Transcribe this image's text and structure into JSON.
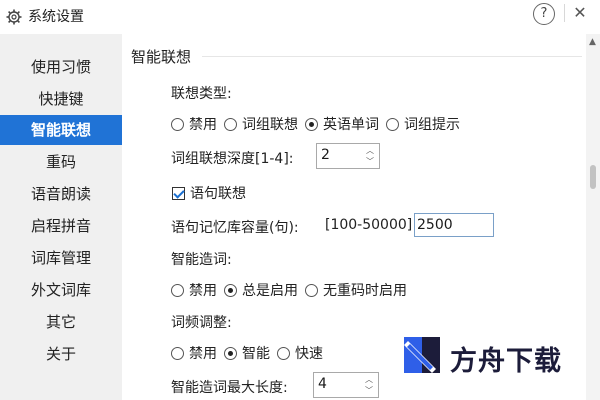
{
  "window": {
    "title": "系统设置",
    "help_label": "?",
    "close_label": "✕"
  },
  "sidebar": {
    "items": [
      {
        "label": "使用习惯"
      },
      {
        "label": "快捷键"
      },
      {
        "label": "智能联想",
        "active": true
      },
      {
        "label": "重码"
      },
      {
        "label": "语音朗读"
      },
      {
        "label": "启程拼音"
      },
      {
        "label": "词库管理"
      },
      {
        "label": "外文词库"
      },
      {
        "label": "其它"
      },
      {
        "label": "关于"
      }
    ]
  },
  "content": {
    "section_title": "智能联想",
    "assoc_type": {
      "label": "联想类型:",
      "options": [
        "禁用",
        "词组联想",
        "英语单词",
        "词组提示"
      ],
      "selected": "英语单词"
    },
    "phrase_depth": {
      "label": "词组联想深度[1-4]:",
      "value": "2"
    },
    "sentence_assoc": {
      "label": "语句联想",
      "checked": true
    },
    "sentence_memory": {
      "label": "语句记忆库容量(句):",
      "range": "[100-50000]",
      "value": "2500"
    },
    "smart_word": {
      "label": "智能造词:",
      "options": [
        "禁用",
        "总是启用",
        "无重码时启用"
      ],
      "selected": "总是启用"
    },
    "freq_adjust": {
      "label": "词频调整:",
      "options": [
        "禁用",
        "智能",
        "快速"
      ],
      "selected": "智能"
    },
    "max_length": {
      "label": "智能造词最大长度:",
      "value": "4"
    }
  },
  "watermark": {
    "text": "方舟下载",
    "colors": {
      "blue": "#2f5fe8",
      "dark": "#1c1c3a"
    }
  },
  "icons": {
    "settings": "gear-icon",
    "spin_up": "chevron-up-icon",
    "spin_down": "chevron-down-icon",
    "scroll_up": "triangle-up-icon"
  },
  "colors": {
    "accent": "#2073d6",
    "sidebar_bg": "#f0f0f0"
  }
}
